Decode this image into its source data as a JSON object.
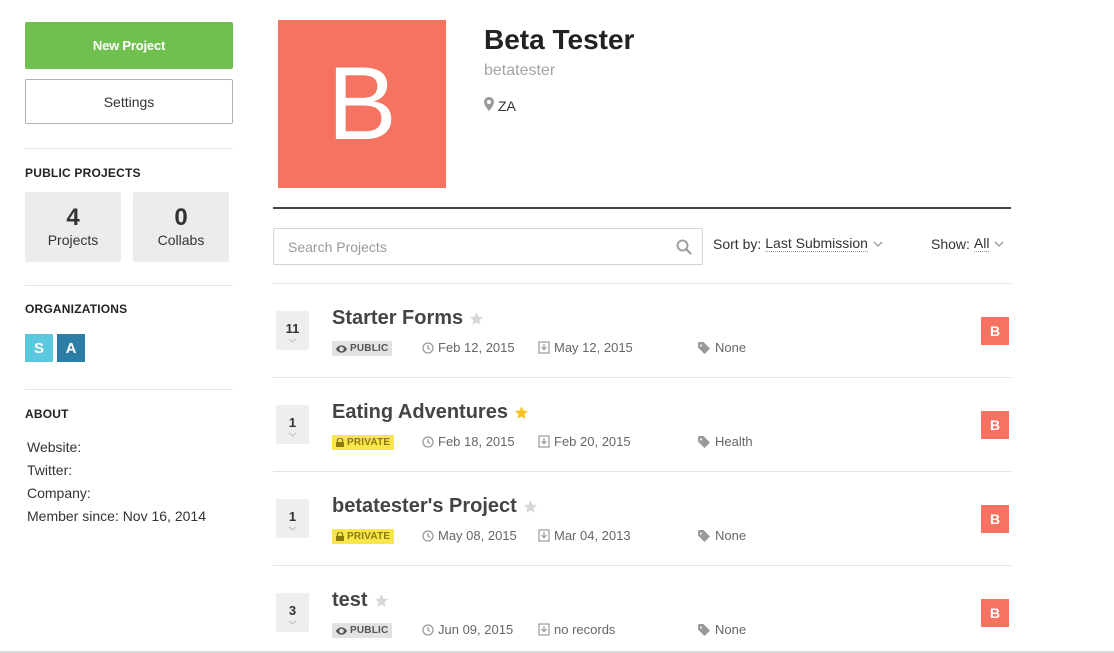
{
  "sidebar": {
    "new_project_label": "New Project",
    "settings_label": "Settings",
    "public_projects_title": "PUBLIC PROJECTS",
    "stats": [
      {
        "value": "4",
        "label": "Projects"
      },
      {
        "value": "0",
        "label": "Collabs"
      }
    ],
    "organizations_title": "ORGANIZATIONS",
    "organizations": [
      {
        "letter": "S",
        "color": "#5bc8de"
      },
      {
        "letter": "A",
        "color": "#2c7ea6"
      }
    ],
    "about_title": "ABOUT",
    "about": {
      "website": "Website:",
      "twitter": "Twitter:",
      "company": "Company:",
      "member_since": "Member since: Nov 16, 2014"
    }
  },
  "profile": {
    "avatar_letter": "B",
    "avatar_color": "#f67361",
    "name": "Beta Tester",
    "username": "betatester",
    "location": "ZA"
  },
  "toolbar": {
    "search_placeholder": "Search Projects",
    "sort_label": "Sort by:",
    "sort_value": "Last Submission",
    "show_label": "Show:",
    "show_value": "All"
  },
  "projects": [
    {
      "count": "11",
      "title": "Starter Forms",
      "starred": false,
      "visibility": "PUBLIC",
      "created": "Feb 12, 2015",
      "last_submission": "May 12, 2015",
      "tag": "None",
      "owner": "B"
    },
    {
      "count": "1",
      "title": "Eating Adventures",
      "starred": true,
      "visibility": "PRIVATE",
      "created": "Feb 18, 2015",
      "last_submission": "Feb 20, 2015",
      "tag": "Health",
      "owner": "B"
    },
    {
      "count": "1",
      "title": "betatester's Project",
      "starred": false,
      "visibility": "PRIVATE",
      "created": "May 08, 2015",
      "last_submission": "Mar 04, 2013",
      "tag": "None",
      "owner": "B"
    },
    {
      "count": "3",
      "title": "test",
      "starred": false,
      "visibility": "PUBLIC",
      "created": "Jun 09, 2015",
      "last_submission": "no records",
      "tag": "None",
      "owner": "B"
    }
  ],
  "colors": {
    "accent_green": "#70c04f",
    "owner_badge": "#f67361",
    "star_active": "#f5c11c",
    "star_inactive": "#d8d8d8",
    "private_badge": "#f9e64a",
    "public_badge": "#e2e2e2"
  }
}
